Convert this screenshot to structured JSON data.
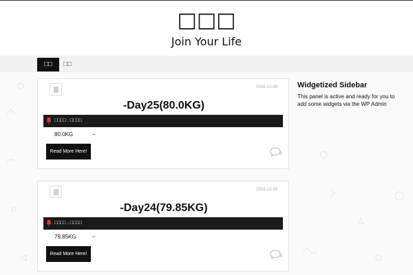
{
  "header": {
    "site_title": "□□□",
    "tagline": "Join Your Life"
  },
  "nav": {
    "items": [
      {
        "label": "□□",
        "active": true
      },
      {
        "label": "□□",
        "active": false
      }
    ]
  },
  "posts": [
    {
      "date": "2016-12-28",
      "title": "-Day25(80.0KG)",
      "meta": "□□□□ . □□□□",
      "weight": "80.0KG",
      "dash": "–",
      "read_more": "Read More Here!",
      "comments": "0"
    },
    {
      "date": "2016-12-29",
      "title": "-Day24(79.85KG)",
      "meta": "□□□□ . □□□□",
      "weight": "79.85KG",
      "dash": "–",
      "read_more": "Read More Here!",
      "comments": "0"
    }
  ],
  "sidebar": {
    "title": "Widgetized Sidebar",
    "text": "This panel is active and ready for you to add some widgets via the WP Admin"
  },
  "colors": {
    "accent": "#111111",
    "meta_bar": "#1a1a1a",
    "pin": "#e0393e"
  }
}
